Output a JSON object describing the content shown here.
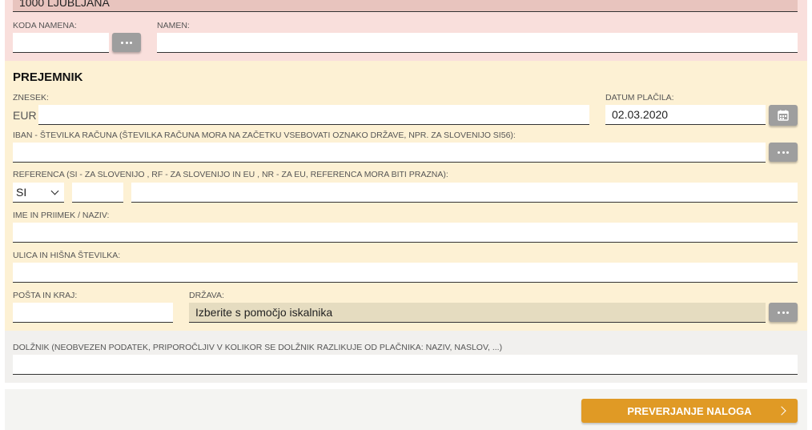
{
  "payer": {
    "city_value": "1000 LJUBLJANA",
    "purpose_code_label": "KODA NAMENA:",
    "purpose_code_value": "",
    "purpose_label": "NAMEN:",
    "purpose_value": ""
  },
  "recipient": {
    "title": "PREJEMNIK",
    "amount_label": "ZNESEK:",
    "currency": "EUR",
    "amount_value": "",
    "date_label": "DATUM PLAČILA:",
    "date_value": "02.03.2020",
    "iban_label": "IBAN - ŠTEVILKA RAČUNA (ŠTEVILKA RAČUNA MORA NA ZAČETKU VSEBOVATI OZNAKO DRŽAVE, NPR. ZA SLOVENIJO SI56):",
    "iban_value": "",
    "reference_label": "REFERENCA (SI - ZA SLOVENIJO , RF - ZA SLOVENIJO IN EU , NR - ZA EU, REFERENCA MORA BITI PRAZNA):",
    "reference_prefix": "SI",
    "reference_model": "",
    "reference_number": "",
    "name_label": "IME IN PRIIMEK / NAZIV:",
    "name_value": "",
    "street_label": "ULICA IN HIŠNA ŠTEVILKA:",
    "street_value": "",
    "post_label": "POŠTA IN KRAJ:",
    "post_value": "",
    "country_label": "DRŽAVA:",
    "country_placeholder": "Izberite s pomočjo iskalnika"
  },
  "debtor": {
    "label": "DOLŽNIK (NEOBVEZEN PODATEK, PRIPOROČLJIV V KOLIKOR SE DOLŽNIK RAZLIKUJE OD PLAČNIKA: NAZIV, NASLOV, ...)",
    "value": ""
  },
  "footer": {
    "check_button": "PREVERJANJE NALOGA"
  },
  "colors": {
    "payer_bg": "#f9dfdc",
    "recipient_bg": "#fdf1d4",
    "accent": "#e09a25"
  },
  "icons": {
    "lookup": "ellipsis-icon",
    "calendar": "calendar-icon",
    "next": "chevron-right-icon",
    "dropdown": "chevron-down-icon"
  }
}
